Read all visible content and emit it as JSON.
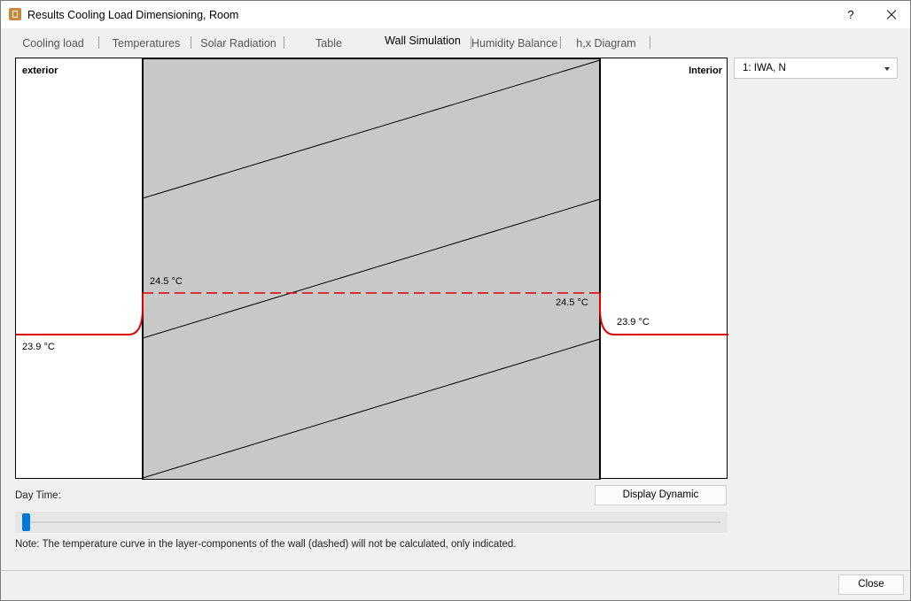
{
  "window": {
    "title": "Results Cooling Load Dimensioning, Room",
    "help_label": "?"
  },
  "tabs": [
    {
      "label": "Cooling load"
    },
    {
      "label": "Temperatures"
    },
    {
      "label": "Solar Radiation"
    },
    {
      "label": "Table"
    },
    {
      "label": "Wall Simulation",
      "active": true
    },
    {
      "label": "Humidity Balance"
    },
    {
      "label": "h,x Diagram"
    }
  ],
  "plot": {
    "exterior_label": "exterior",
    "interior_label": "Interior",
    "temp_wall_exterior_side": "24.5 °C",
    "temp_wall_interior_side": "24.5 °C",
    "temp_exterior_air": "23.9 °C",
    "temp_interior_air": "23.9 °C",
    "colors": {
      "wall_fill": "#c8c8c8",
      "temperature_curve": "#e00000",
      "layer_lines": "#000000"
    }
  },
  "layer_select": {
    "value": "1: IWA, N"
  },
  "controls": {
    "day_time_label": "Day Time:",
    "display_dynamic_label": "Display Dynamic",
    "slider_value": 0.0,
    "note": "Note: The temperature curve in the layer-components of the wall (dashed) will not be calculated, only indicated."
  },
  "footer": {
    "close_label": "Close"
  }
}
